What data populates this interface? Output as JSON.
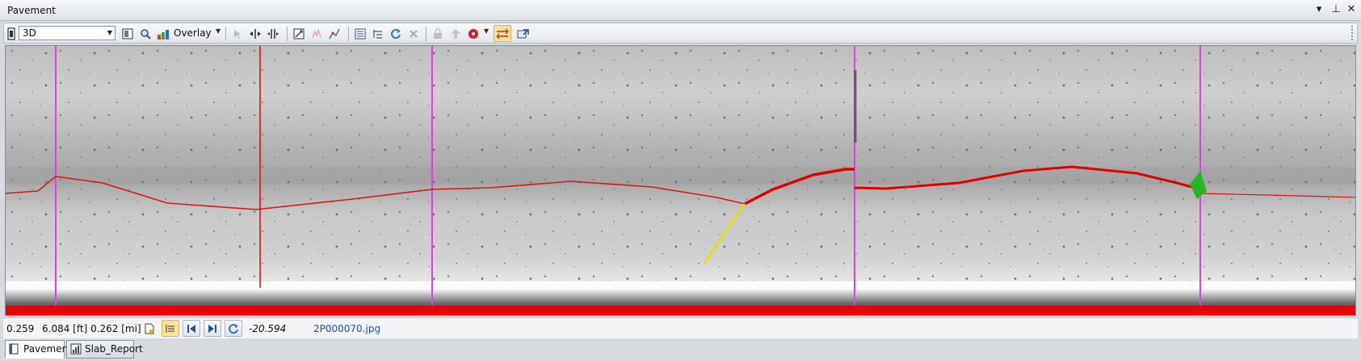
{
  "window": {
    "title": "Pavement",
    "controls": {
      "menu": "▾",
      "pin": "⊥",
      "close": "✕"
    }
  },
  "toolbar": {
    "view_mode": "3D",
    "overlay_label": "Overlay",
    "icons": [
      "film-icon",
      "page-view-icon",
      "zoom-icon",
      "color-palette-icon",
      "pointer-icon",
      "fit-width-icon",
      "split-icon",
      "zoom-extents-icon",
      "crack-draw-icon",
      "polyline-icon",
      "list-icon",
      "list-tree-icon",
      "refresh-icon",
      "delete-icon",
      "lock-icon",
      "upload-icon",
      "record-icon",
      "swap-icon",
      "export-icon"
    ]
  },
  "status": {
    "value": "0.259",
    "distance": "6.084 [ft] 0.262 [mi]",
    "offset": "-20.594",
    "filename": "2P000070.jpg"
  },
  "tabs": [
    {
      "label": "Pavement",
      "icon": "document-icon",
      "selected": true
    },
    {
      "label": "Slab_Report",
      "icon": "report-chart-icon",
      "selected": false
    }
  ],
  "colors": {
    "crack": "#e00000",
    "joint": "#e040e0",
    "sealed_crack": "#e8e000",
    "patch": "#20c020",
    "cursor": "#e00000"
  }
}
